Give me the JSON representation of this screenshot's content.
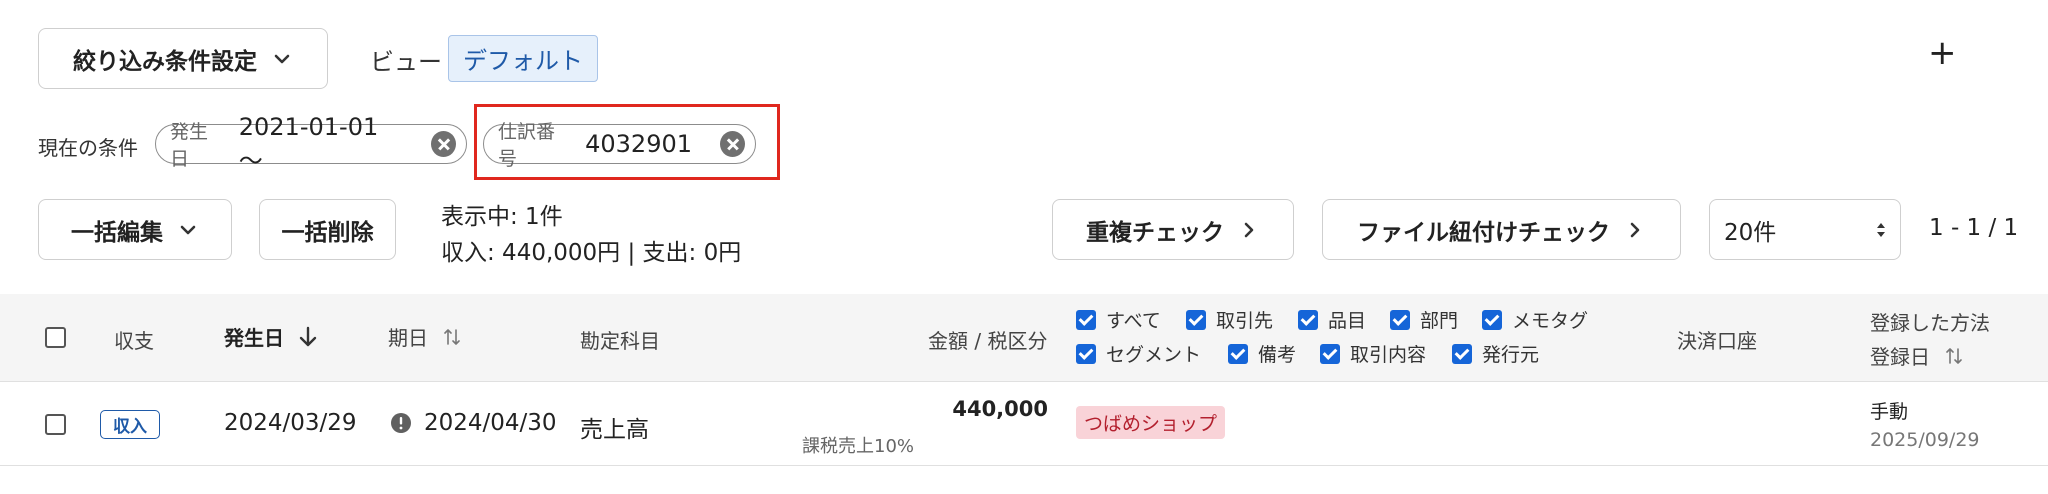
{
  "toolbar": {
    "filter_settings_label": "絞り込み条件設定",
    "view_label": "ビュー",
    "view_value": "デフォルト",
    "add_label": "+"
  },
  "conditions": {
    "label": "現在の条件",
    "chips": [
      {
        "key": "発生日",
        "value": "2021-01-01 〜"
      },
      {
        "key": "仕訳番号",
        "value": "4032901"
      }
    ]
  },
  "actions": {
    "bulk_edit_label": "一括編集",
    "bulk_delete_label": "一括削除",
    "display_count": "表示中: 1件",
    "summary": "収入: 440,000円 | 支出: 0円",
    "duplicate_check_label": "重複チェック",
    "file_link_check_label": "ファイル紐付けチェック",
    "page_size": "20件",
    "pagination": "1 - 1 / 1"
  },
  "table": {
    "headers": {
      "type": "収支",
      "date": "発生日",
      "due": "期日",
      "account": "勘定科目",
      "amount": "金額 / 税区分",
      "payment_account": "決済口座",
      "registered_method": "登録した方法",
      "registered_date": "登録日"
    },
    "column_options": [
      {
        "label": "すべて",
        "checked": true
      },
      {
        "label": "取引先",
        "checked": true
      },
      {
        "label": "品目",
        "checked": true
      },
      {
        "label": "部門",
        "checked": true
      },
      {
        "label": "メモタグ",
        "checked": true
      },
      {
        "label": "セグメント",
        "checked": true
      },
      {
        "label": "備考",
        "checked": true
      },
      {
        "label": "取引内容",
        "checked": true
      },
      {
        "label": "発行元",
        "checked": true
      }
    ],
    "rows": [
      {
        "type": "収入",
        "date": "2024/03/29",
        "due": "2024/04/30",
        "account": "売上高",
        "amount": "440,000",
        "tax": "課税売上10%",
        "partner": "つばめショップ",
        "method": "手動",
        "registered": "2025/09/29"
      }
    ]
  },
  "colors": {
    "highlight": "#e0281e",
    "view_tag_bg": "#e6f0fb",
    "view_tag_text": "#1f5aa8",
    "income_badge": "#1f5aa8",
    "partner_tag_bg": "#f9d3d8",
    "partner_tag_text": "#b3202e",
    "checkbox": "#1565d8"
  }
}
